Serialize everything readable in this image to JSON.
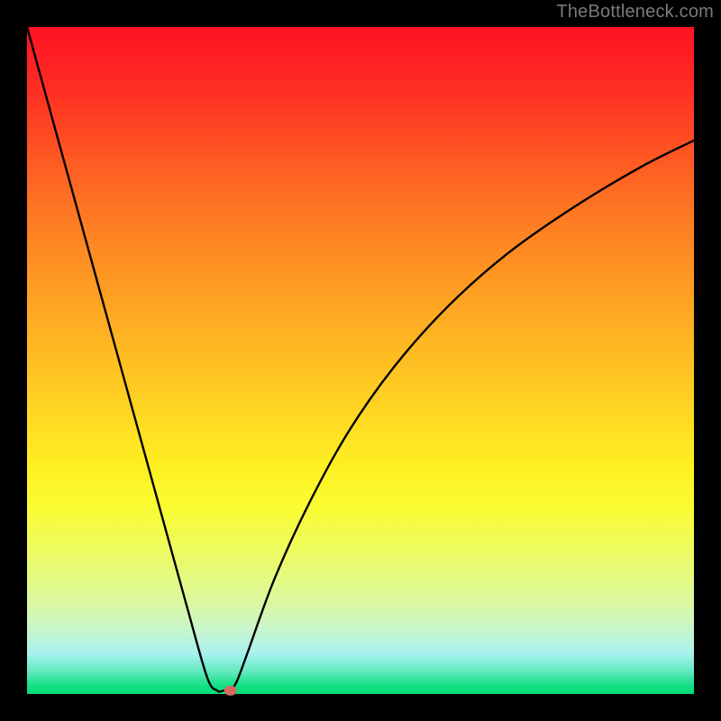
{
  "watermark": "TheBottleneck.com",
  "chart_data": {
    "type": "line",
    "title": "",
    "xlabel": "",
    "ylabel": "",
    "xlim": [
      0,
      100
    ],
    "ylim": [
      0,
      100
    ],
    "grid": false,
    "legend": false,
    "series": [
      {
        "name": "bottleneck-curve",
        "x": [
          0,
          4,
          8,
          12,
          16,
          20,
          24,
          27,
          28.5,
          29.5,
          30.5,
          31.5,
          33,
          37,
          42,
          48,
          55,
          63,
          72,
          82,
          92,
          100
        ],
        "values": [
          100,
          85.5,
          71,
          56.5,
          42,
          27.5,
          13,
          2.5,
          0.5,
          0.5,
          0.5,
          2,
          6,
          17,
          28,
          39,
          49,
          58,
          66,
          73,
          79,
          83
        ]
      }
    ],
    "annotations": [
      {
        "name": "optimal-point",
        "x": 30.5,
        "y": 0.5
      }
    ],
    "colors": {
      "curve": "#000000",
      "marker": "#d46a5f",
      "bg_top": "#fe1423",
      "bg_bottom": "#03dd79"
    }
  }
}
